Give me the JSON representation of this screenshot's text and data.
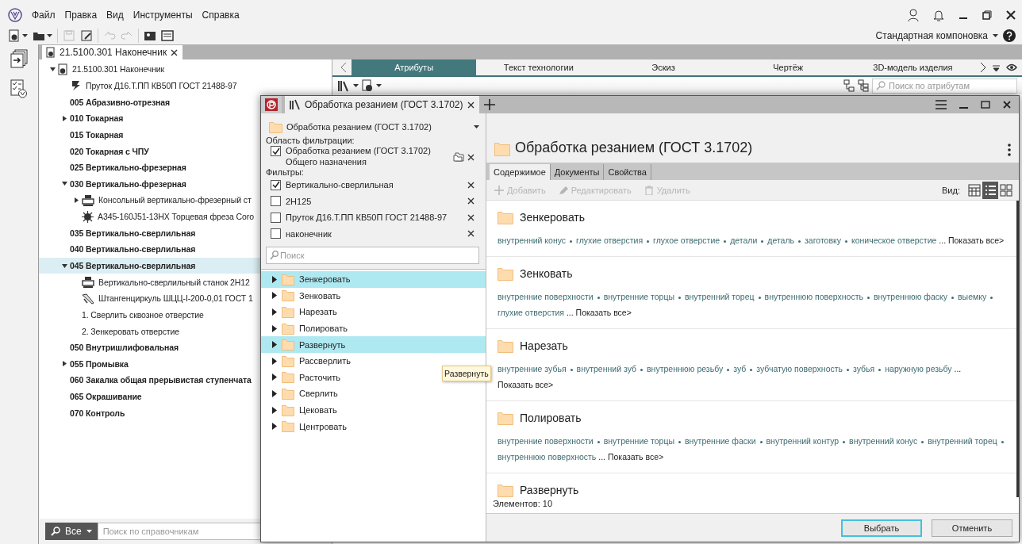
{
  "menu": [
    "Файл",
    "Правка",
    "Вид",
    "Инструменты",
    "Справка"
  ],
  "toolbar": [
    {
      "kind": "new",
      "menu": true,
      "disabled": false
    },
    {
      "kind": "open",
      "menu": true,
      "disabled": false
    },
    {
      "kind": "save",
      "menu": false,
      "disabled": true
    },
    {
      "kind": "save_as",
      "menu": false,
      "disabled": false
    },
    {
      "kind": "undo",
      "menu": false,
      "disabled": true
    },
    {
      "kind": "redo",
      "menu": false,
      "disabled": true
    },
    {
      "kind": "card",
      "menu": false,
      "disabled": false
    },
    {
      "kind": "form",
      "menu": false,
      "disabled": false
    }
  ],
  "layout_selector": "Стандартная компоновка",
  "document_tab": "21.5100.301 Наконечник",
  "tree": [
    {
      "label": "21.5100.301 Наконечник",
      "kind": "root",
      "expanded": true,
      "selected": false,
      "children": [
        {
          "label": "Пруток Д16.Т.ПП КВ50П ГОСТ 21488-97",
          "kind": "material",
          "selected": false
        },
        {
          "label": "005 Абразивно-отрезная",
          "kind": "operation",
          "selected": false
        },
        {
          "label": "010 Токарная",
          "kind": "operation",
          "expanded": false,
          "selected": false
        },
        {
          "label": "015 Токарная",
          "kind": "operation",
          "selected": false
        },
        {
          "label": "020 Токарная с ЧПУ",
          "kind": "operation",
          "selected": false
        },
        {
          "label": "025 Вертикально-фрезерная",
          "kind": "operation",
          "selected": false
        },
        {
          "label": "030 Вертикально-фрезерная",
          "kind": "operation",
          "expanded": true,
          "selected": false,
          "children": [
            {
              "label": "Консольный вертикально-фрезерный ст",
              "kind": "equipment",
              "expanded": false,
              "selected": false
            },
            {
              "label": "А345-160J51-13НХ Торцевая фреза Coro",
              "kind": "tool",
              "selected": false
            }
          ]
        },
        {
          "label": "035 Вертикально-сверлильная",
          "kind": "operation",
          "selected": false
        },
        {
          "label": "040 Вертикально-сверлильная",
          "kind": "operation",
          "selected": false
        },
        {
          "label": "045 Вертикально-сверлильная",
          "kind": "operation",
          "expanded": true,
          "selected": true,
          "children": [
            {
              "label": "Вертикально-сверлильный станок 2Н12",
              "kind": "equipment",
              "selected": false
            },
            {
              "label": "Штангенциркуль ШЦЦ-I-200-0,01 ГОСТ 1",
              "kind": "gauge",
              "selected": false
            },
            {
              "label": "1. Сверлить сквозное отверстие",
              "kind": "step",
              "selected": false
            },
            {
              "label": "2. Зенкеровать отверстие",
              "kind": "step",
              "selected": false
            }
          ]
        },
        {
          "label": "050 Внутришлифовальная",
          "kind": "operation",
          "selected": false
        },
        {
          "label": "055 Промывка",
          "kind": "operation",
          "expanded": false,
          "selected": false
        },
        {
          "label": "060 Закалка общая прерывистая ступенчата",
          "kind": "operation",
          "selected": false
        },
        {
          "label": "065 Окрашивание",
          "kind": "operation",
          "selected": false
        },
        {
          "label": "070 Контроль",
          "kind": "operation",
          "selected": false
        }
      ]
    }
  ],
  "reference_search": {
    "scope": "Все",
    "placeholder": "Поиск по справочникам"
  },
  "view_tabs": [
    {
      "label": "Атрибуты",
      "selected": true
    },
    {
      "label": "Текст технологии",
      "selected": false
    },
    {
      "label": "Эскиз",
      "selected": false
    },
    {
      "label": "Чертёж",
      "selected": false
    },
    {
      "label": "3D-модель изделия",
      "selected": false
    }
  ],
  "attribute_search": {
    "placeholder": "Поиск по атрибутам"
  },
  "dialog": {
    "tab": "Обработка резанием (ГОСТ 3.1702)",
    "catalog": "Обработка резанием (ГОСТ 3.1702)",
    "filter_scope_label": "Область фильтрации:",
    "filter_scope": {
      "label": "Обработка резанием (ГОСТ 3.1702)",
      "sublabel": "Общего назначения",
      "checked": true
    },
    "filters_label": "Фильтры:",
    "filters": [
      {
        "label": "Вертикально-сверлильная",
        "checked": true
      },
      {
        "label": "2Н125",
        "checked": false
      },
      {
        "label": "Пруток Д16.Т.ПП КВ50П ГОСТ 21488-97",
        "checked": false
      },
      {
        "label": "наконечник",
        "checked": false
      }
    ],
    "search_placeholder": "Поиск",
    "folders": [
      {
        "label": "Зенкеровать",
        "selected": true
      },
      {
        "label": "Зенковать",
        "selected": false
      },
      {
        "label": "Нарезать",
        "selected": false
      },
      {
        "label": "Полировать",
        "selected": false
      },
      {
        "label": "Развернуть",
        "selected": true
      },
      {
        "label": "Рассверлить",
        "selected": false
      },
      {
        "label": "Расточить",
        "selected": false
      },
      {
        "label": "Сверлить",
        "selected": false
      },
      {
        "label": "Цековать",
        "selected": false
      },
      {
        "label": "Центровать",
        "selected": false
      }
    ],
    "tooltip": "Развернуть",
    "title": "Обработка резанием (ГОСТ 3.1702)",
    "tabs": [
      {
        "label": "Содержимое",
        "selected": true
      },
      {
        "label": "Документы",
        "selected": false
      },
      {
        "label": "Свойства",
        "selected": false
      }
    ],
    "actions": [
      {
        "kind": "add",
        "label": "Добавить",
        "disabled": true
      },
      {
        "kind": "edit",
        "label": "Редактировать",
        "disabled": true
      },
      {
        "kind": "delete",
        "label": "Удалить",
        "disabled": true
      }
    ],
    "view_label": "Вид:",
    "view_modes": [
      {
        "kind": "table",
        "selected": false
      },
      {
        "kind": "list",
        "selected": true
      },
      {
        "kind": "tiles",
        "selected": false
      }
    ],
    "items": [
      {
        "title": "Зенкеровать",
        "tags": [
          "внутренний конус",
          "глухие отверстия",
          "глухое отверстие",
          "детали",
          "деталь",
          "заготовку",
          "коническое отверстие"
        ],
        "ellipsis": "...",
        "more": "Показать все>"
      },
      {
        "title": "Зенковать",
        "tags": [
          "внутренние поверхности",
          "внутренние торцы",
          "внутренний торец",
          "внутреннюю поверхность",
          "внутреннюю фаску",
          "выемку",
          "глухие отверстия"
        ],
        "ellipsis": "...",
        "more": "Показать все>"
      },
      {
        "title": "Нарезать",
        "tags": [
          "внутренние зубья",
          "внутренний зуб",
          "внутреннюю резьбу",
          "зуб",
          "зубчатую поверхность",
          "зубья",
          "наружную резьбу"
        ],
        "ellipsis": "...",
        "more": "Показать все>"
      },
      {
        "title": "Полировать",
        "tags": [
          "внутренние поверхности",
          "внутренние торцы",
          "внутренние фаски",
          "внутренний контур",
          "внутренний конус",
          "внутренний торец",
          "внутреннюю поверхность"
        ],
        "ellipsis": "...",
        "more": "Показать все>"
      },
      {
        "title": "Развернуть"
      }
    ],
    "count": "Элементов: 10",
    "buttons": [
      {
        "label": "Выбрать",
        "default": true
      },
      {
        "label": "Отменить",
        "default": false
      }
    ]
  }
}
